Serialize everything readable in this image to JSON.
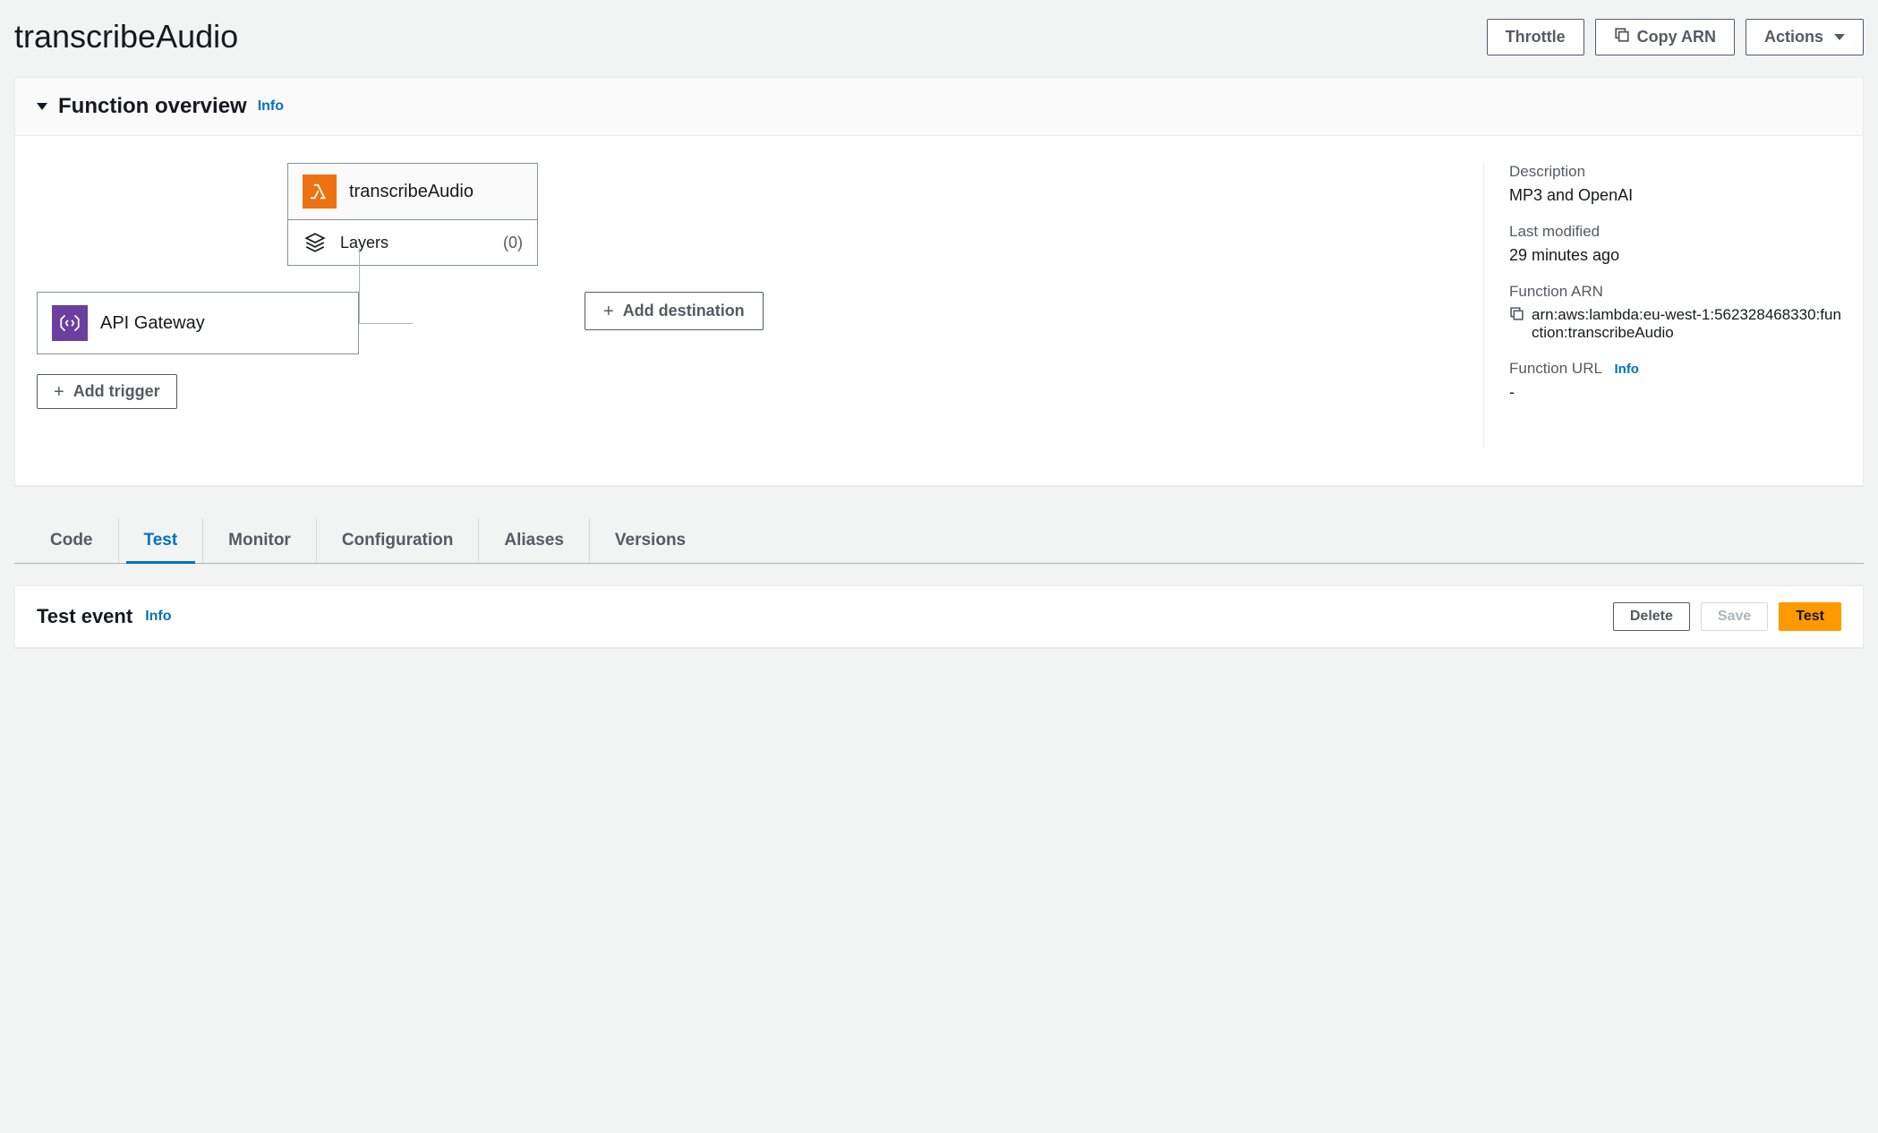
{
  "header": {
    "title": "transcribeAudio",
    "buttons": {
      "throttle": "Throttle",
      "copy_arn": "Copy ARN",
      "actions": "Actions"
    }
  },
  "overview": {
    "section_title": "Function overview",
    "info": "Info",
    "function_name": "transcribeAudio",
    "layers_label": "Layers",
    "layers_count": "(0)",
    "trigger_name": "API Gateway",
    "add_trigger": "Add trigger",
    "add_destination": "Add destination",
    "meta": {
      "description_label": "Description",
      "description_value": "MP3 and OpenAI",
      "modified_label": "Last modified",
      "modified_value": "29 minutes ago",
      "arn_label": "Function ARN",
      "arn_value": "arn:aws:lambda:eu-west-1:562328468330:function:transcribeAudio",
      "url_label": "Function URL",
      "url_info": "Info",
      "url_value": "-"
    }
  },
  "tabs": {
    "code": "Code",
    "test": "Test",
    "monitor": "Monitor",
    "configuration": "Configuration",
    "aliases": "Aliases",
    "versions": "Versions"
  },
  "test_section": {
    "title": "Test event",
    "info": "Info",
    "delete": "Delete",
    "save": "Save",
    "test": "Test"
  }
}
